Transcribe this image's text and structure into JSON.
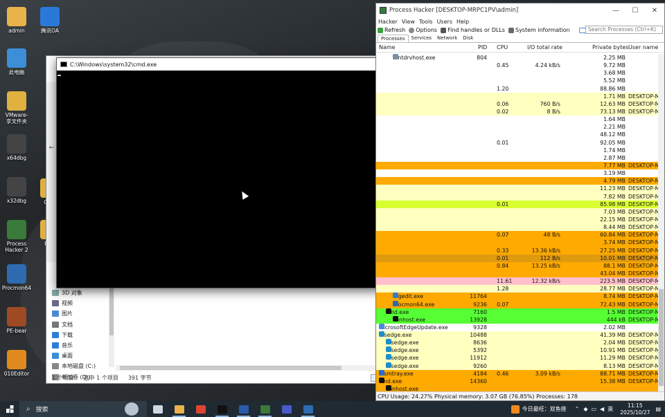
{
  "desktop": {
    "icons": [
      {
        "label": "admin",
        "color": "#e8b34a"
      },
      {
        "label": "此电脑",
        "color": "#3d8ed8"
      },
      {
        "label": "VMware-\n享文件夹",
        "color": "#e0b040"
      },
      {
        "label": "x64dbg",
        "color": "#444"
      },
      {
        "label": "x32dbg",
        "color": "#444"
      },
      {
        "label": "Process\nHacker 2",
        "color": "#3a7a3a"
      },
      {
        "label": "Procmon64",
        "color": "#2e6bb0"
      },
      {
        "label": "PE-bear",
        "color": "#a04a24"
      },
      {
        "label": "010Editor",
        "color": "#e08a20"
      },
      {
        "label": "腾讯OA",
        "color": "#2979d9"
      },
      {
        "label": "COM",
        "color": "#e0b040"
      },
      {
        "label": "EDR",
        "color": "#e0b040"
      }
    ]
  },
  "explorer": {
    "nav_items": [
      {
        "label": "3D 对象",
        "color": "#8aa"
      },
      {
        "label": "视频",
        "color": "#6a6a8a"
      },
      {
        "label": "图片",
        "color": "#4d8bd0"
      },
      {
        "label": "文档",
        "color": "#777"
      },
      {
        "label": "下载",
        "color": "#2f7ed8"
      },
      {
        "label": "音乐",
        "color": "#2f7ed8"
      },
      {
        "label": "桌面",
        "color": "#3d8ed8"
      },
      {
        "label": "本地磁盘 (C:)",
        "color": "#888"
      },
      {
        "label": "新加卷 (D:)",
        "color": "#888"
      }
    ],
    "status": {
      "count": "1 个项目",
      "selected": "选中 1 个项目",
      "size": "391 字节"
    }
  },
  "cmd": {
    "title": "C:\\Windows\\system32\\cmd.exe",
    "min": "—",
    "max": "☐",
    "close": "✕"
  },
  "process_hacker": {
    "title": "Process Hacker [DESKTOP-MRPC1PV\\admin]",
    "min": "—",
    "max": "☐",
    "close": "✕",
    "menu": [
      "Hacker",
      "View",
      "Tools",
      "Users",
      "Help"
    ],
    "toolbar": {
      "refresh": "Refresh",
      "options": "Options",
      "find": "Find handles or DLLs",
      "sysinfo": "System information",
      "search_placeholder": "Search Processes (Ctrl+K)"
    },
    "tabs": [
      "Processes",
      "Services",
      "Network",
      "Disk"
    ],
    "columns": {
      "name": "Name",
      "pid": "PID",
      "cpu": "CPU",
      "io": "I/O total rate",
      "priv": "Private bytes",
      "user": "User name"
    },
    "rows": [
      {
        "name": "fontdrvhost.exe",
        "pid": "804",
        "cpu": "",
        "io": "",
        "priv": "2.25 MB",
        "user": "",
        "bg": "#ffffff",
        "indent": 2,
        "icon": "#7a8fa8"
      },
      {
        "name": "",
        "pid": "",
        "cpu": "0.45",
        "io": "4.24 kB/s",
        "priv": "9.72 MB",
        "user": "",
        "bg": "#ffffff",
        "indent": 0,
        "icon": ""
      },
      {
        "name": "",
        "pid": "",
        "cpu": "",
        "io": "",
        "priv": "3.68 MB",
        "user": "",
        "bg": "#ffffff",
        "indent": 0,
        "icon": ""
      },
      {
        "name": "",
        "pid": "",
        "cpu": "",
        "io": "",
        "priv": "5.52 MB",
        "user": "",
        "bg": "#ffffff",
        "indent": 0,
        "icon": ""
      },
      {
        "name": "",
        "pid": "",
        "cpu": "1.20",
        "io": "",
        "priv": "88.86 MB",
        "user": "",
        "bg": "#ffffff",
        "indent": 0,
        "icon": ""
      },
      {
        "name": "",
        "pid": "",
        "cpu": "",
        "io": "",
        "priv": "1.71 MB",
        "user": "DESKTOP-M",
        "bg": "#ffffc0",
        "indent": 0,
        "icon": ""
      },
      {
        "name": "",
        "pid": "",
        "cpu": "0.06",
        "io": "760 B/s",
        "priv": "12.63 MB",
        "user": "DESKTOP-M",
        "bg": "#ffffc0",
        "indent": 0,
        "icon": ""
      },
      {
        "name": "",
        "pid": "",
        "cpu": "0.02",
        "io": "8 B/s",
        "priv": "73.13 MB",
        "user": "DESKTOP-M",
        "bg": "#ffffc0",
        "indent": 0,
        "icon": ""
      },
      {
        "name": "",
        "pid": "",
        "cpu": "",
        "io": "",
        "priv": "1.64 MB",
        "user": "",
        "bg": "#ffffff",
        "indent": 0,
        "icon": ""
      },
      {
        "name": "",
        "pid": "",
        "cpu": "",
        "io": "",
        "priv": "2.21 MB",
        "user": "",
        "bg": "#ffffff",
        "indent": 0,
        "icon": ""
      },
      {
        "name": "",
        "pid": "",
        "cpu": "",
        "io": "",
        "priv": "48.12 MB",
        "user": "",
        "bg": "#ffffff",
        "indent": 0,
        "icon": ""
      },
      {
        "name": "",
        "pid": "",
        "cpu": "0.01",
        "io": "",
        "priv": "92.05 MB",
        "user": "",
        "bg": "#ffffff",
        "indent": 0,
        "icon": ""
      },
      {
        "name": "",
        "pid": "",
        "cpu": "",
        "io": "",
        "priv": "1.74 MB",
        "user": "",
        "bg": "#ffffff",
        "indent": 0,
        "icon": ""
      },
      {
        "name": "",
        "pid": "",
        "cpu": "",
        "io": "",
        "priv": "2.87 MB",
        "user": "",
        "bg": "#ffffff",
        "indent": 0,
        "icon": ""
      },
      {
        "name": "",
        "pid": "",
        "cpu": "",
        "io": "",
        "priv": "7.77 MB",
        "user": "DESKTOP-M",
        "bg": "#ffaa00",
        "indent": 0,
        "icon": ""
      },
      {
        "name": "",
        "pid": "",
        "cpu": "",
        "io": "",
        "priv": "3.19 MB",
        "user": "",
        "bg": "#ffffff",
        "indent": 0,
        "icon": ""
      },
      {
        "name": "",
        "pid": "",
        "cpu": "",
        "io": "",
        "priv": "4.79 MB",
        "user": "DESKTOP-M",
        "bg": "#ffaa00",
        "indent": 0,
        "icon": ""
      },
      {
        "name": "",
        "pid": "",
        "cpu": "",
        "io": "",
        "priv": "11.23 MB",
        "user": "DESKTOP-M",
        "bg": "#ffffc0",
        "indent": 0,
        "icon": ""
      },
      {
        "name": "",
        "pid": "",
        "cpu": "",
        "io": "",
        "priv": "7.82 MB",
        "user": "DESKTOP-M",
        "bg": "#ffffc0",
        "indent": 0,
        "icon": ""
      },
      {
        "name": "",
        "pid": "",
        "cpu": "0.01",
        "io": "",
        "priv": "85.98 MB",
        "user": "DESKTOP-M",
        "bg": "#d8ff30",
        "indent": 0,
        "icon": ""
      },
      {
        "name": "",
        "pid": "",
        "cpu": "",
        "io": "",
        "priv": "7.03 MB",
        "user": "DESKTOP-M",
        "bg": "#ffffc0",
        "indent": 0,
        "icon": ""
      },
      {
        "name": "",
        "pid": "",
        "cpu": "",
        "io": "",
        "priv": "22.15 MB",
        "user": "DESKTOP-M",
        "bg": "#ffffc0",
        "indent": 0,
        "icon": ""
      },
      {
        "name": "",
        "pid": "",
        "cpu": "",
        "io": "",
        "priv": "8.44 MB",
        "user": "DESKTOP-M",
        "bg": "#ffffc0",
        "indent": 0,
        "icon": ""
      },
      {
        "name": "",
        "pid": "",
        "cpu": "0.07",
        "io": "48 B/s",
        "priv": "60.84 MB",
        "user": "DESKTOP-M",
        "bg": "#ffaa00",
        "indent": 0,
        "icon": ""
      },
      {
        "name": "",
        "pid": "",
        "cpu": "",
        "io": "",
        "priv": "3.74 MB",
        "user": "DESKTOP-M",
        "bg": "#ffaa00",
        "indent": 0,
        "icon": ""
      },
      {
        "name": "",
        "pid": "",
        "cpu": "0.33",
        "io": "13.36 kB/s",
        "priv": "27.25 MB",
        "user": "DESKTOP-M",
        "bg": "#ffaa00",
        "indent": 0,
        "icon": ""
      },
      {
        "name": "",
        "pid": "",
        "cpu": "0.01",
        "io": "112 B/s",
        "priv": "10.01 MB",
        "user": "DESKTOP-M",
        "bg": "#e09a10",
        "indent": 0,
        "icon": ""
      },
      {
        "name": "",
        "pid": "",
        "cpu": "0.84",
        "io": "13.25 kB/s",
        "priv": "88.1 MB",
        "user": "DESKTOP-M",
        "bg": "#ffaa00",
        "indent": 0,
        "icon": ""
      },
      {
        "name": "",
        "pid": "",
        "cpu": "",
        "io": "",
        "priv": "43.04 MB",
        "user": "DESKTOP-M",
        "bg": "#ffaa00",
        "indent": 0,
        "icon": ""
      },
      {
        "name": "",
        "pid": "",
        "cpu": "11.61",
        "io": "12.32 kB/s",
        "priv": "223.5 MB",
        "user": "DESKTOP-M",
        "bg": "#ffc0cc",
        "indent": 0,
        "icon": ""
      },
      {
        "name": "",
        "pid": "",
        "cpu": "1.28",
        "io": "",
        "priv": "28.77 MB",
        "user": "DESKTOP-M",
        "bg": "#ffffc0",
        "indent": 0,
        "icon": ""
      },
      {
        "name": "regedit.exe",
        "pid": "11764",
        "cpu": "",
        "io": "",
        "priv": "8.74 MB",
        "user": "DESKTOP-M",
        "bg": "#ffaa00",
        "indent": 2,
        "icon": "#3a7ac8"
      },
      {
        "name": "Procmon64.exe",
        "pid": "9236",
        "cpu": "0.07",
        "io": "",
        "priv": "72.43 MB",
        "user": "DESKTOP-M",
        "bg": "#ffaa00",
        "indent": 2,
        "icon": "#2e6bb0"
      },
      {
        "name": "cmd.exe",
        "pid": "7160",
        "cpu": "",
        "io": "",
        "priv": "1.5 MB",
        "user": "DESKTOP-M",
        "bg": "#55ff33",
        "indent": 1,
        "icon": "#111111",
        "expand": true
      },
      {
        "name": "conhost.exe",
        "pid": "13928",
        "cpu": "",
        "io": "",
        "priv": "444 kB",
        "user": "DESKTOP-M",
        "bg": "#55ff33",
        "indent": 2,
        "icon": "#111111"
      },
      {
        "name": "MicrosoftEdgeUpdate.exe",
        "pid": "9328",
        "cpu": "",
        "io": "",
        "priv": "2.02 MB",
        "user": "",
        "bg": "#ffffff",
        "indent": 0,
        "icon": "#4a8ad8"
      },
      {
        "name": "msedge.exe",
        "pid": "10488",
        "cpu": "",
        "io": "",
        "priv": "41.39 MB",
        "user": "DESKTOP-M",
        "bg": "#ffffc0",
        "indent": 0,
        "icon": "#1f8fc8",
        "expand": true
      },
      {
        "name": "msedge.exe",
        "pid": "8636",
        "cpu": "",
        "io": "",
        "priv": "2.04 MB",
        "user": "DESKTOP-M",
        "bg": "#ffffc0",
        "indent": 1,
        "icon": "#1f8fc8"
      },
      {
        "name": "msedge.exe",
        "pid": "5392",
        "cpu": "",
        "io": "",
        "priv": "10.91 MB",
        "user": "DESKTOP-M",
        "bg": "#ffffc0",
        "indent": 1,
        "icon": "#1f8fc8"
      },
      {
        "name": "msedge.exe",
        "pid": "11912",
        "cpu": "",
        "io": "",
        "priv": "11.29 MB",
        "user": "DESKTOP-M",
        "bg": "#ffffc0",
        "indent": 1,
        "icon": "#1f8fc8"
      },
      {
        "name": "msedge.exe",
        "pid": "9260",
        "cpu": "",
        "io": "",
        "priv": "8.13 MB",
        "user": "DESKTOP-M",
        "bg": "#ffffc0",
        "indent": 1,
        "icon": "#1f8fc8"
      },
      {
        "name": "ztsmtray.exe",
        "pid": "4184",
        "cpu": "0.46",
        "io": "3.09 kB/s",
        "priv": "88.71 MB",
        "user": "DESKTOP-M",
        "bg": "#ffaa00",
        "indent": 0,
        "icon": "#2a6ad8"
      },
      {
        "name": "cmd.exe",
        "pid": "14360",
        "cpu": "",
        "io": "",
        "priv": "15.38 MB",
        "user": "DESKTOP-M",
        "bg": "#ffaa00",
        "indent": 0,
        "icon": "#111111",
        "expand": true
      },
      {
        "name": "conhost.exe",
        "pid": "",
        "cpu": "",
        "io": "",
        "priv": "",
        "user": "",
        "bg": "#ffaa00",
        "indent": 1,
        "icon": "#111111"
      }
    ],
    "status": "CPU Usage: 24.27%   Physical memory: 3.07 GB (76.85%)   Processes: 178"
  },
  "taskbar": {
    "search_label": "搜索",
    "apps": [
      {
        "name": "task-view",
        "color": "#cfd8e0",
        "open": false
      },
      {
        "name": "file-explorer",
        "color": "#e8b34a",
        "open": true
      },
      {
        "name": "chrome",
        "color": "#dd4433",
        "open": false
      },
      {
        "name": "cmd",
        "color": "#111111",
        "open": true
      },
      {
        "name": "powershell",
        "color": "#2a5caa",
        "open": true
      },
      {
        "name": "process-hacker",
        "color": "#3a7a3a",
        "open": true
      },
      {
        "name": "teams",
        "color": "#4a5bc8",
        "open": false
      },
      {
        "name": "procmon",
        "color": "#2e6bb0",
        "open": true
      }
    ],
    "news": "今日最旺：双鱼座",
    "lang": "英",
    "time": "11:15",
    "date": "2025/10/27"
  }
}
